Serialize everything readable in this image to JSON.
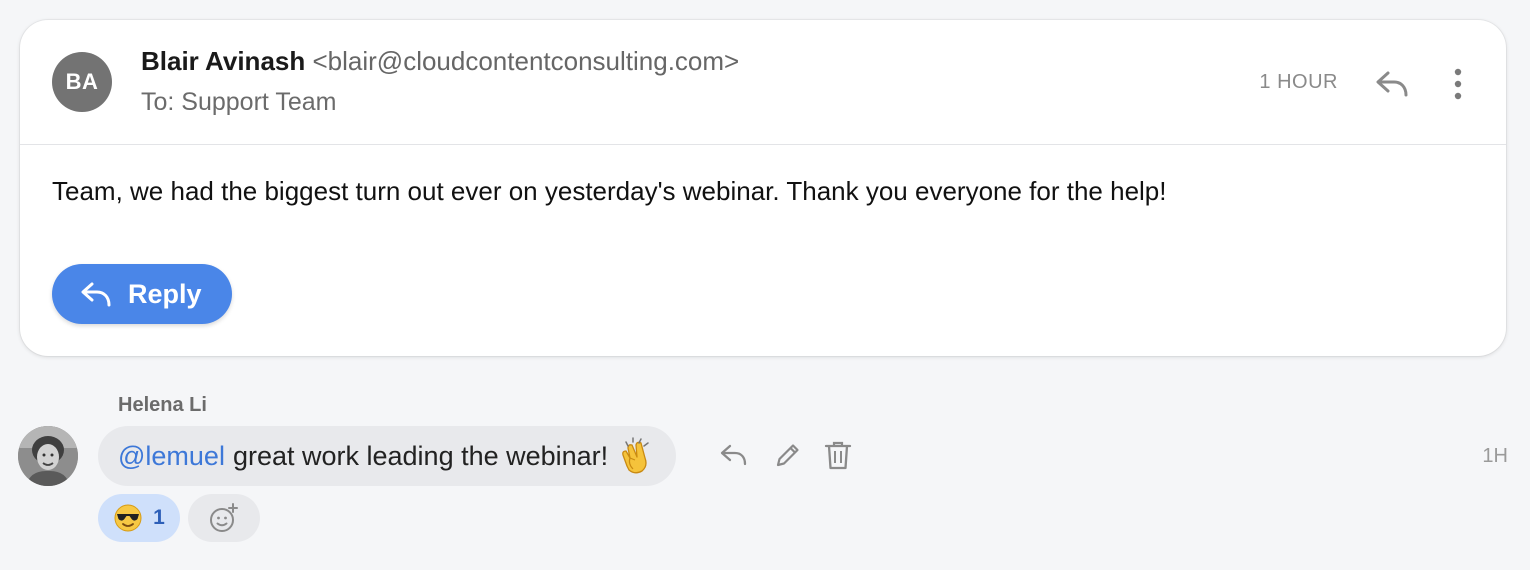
{
  "message": {
    "avatar_initials": "BA",
    "sender_name": "Blair Avinash",
    "sender_email": "<blair@cloudcontentconsulting.com>",
    "to_line": "To: Support Team",
    "time": "1 HOUR",
    "body": "Team, we had the biggest turn out ever on yesterday's webinar. Thank you everyone for the help!",
    "reply_label": "Reply",
    "reply_button_color": "#4a86e8",
    "avatar_color": "#737373",
    "icons": [
      "reply-icon",
      "more-vertical-icon"
    ]
  },
  "comment": {
    "author": "Helena Li",
    "mention": "@lemuel",
    "text": "great work leading the webinar!",
    "text_emoji": "clapping-hands-emoji",
    "time": "1H",
    "mention_color": "#3d78d8",
    "actions": [
      "reply-icon",
      "edit-pencil-icon",
      "trash-icon"
    ],
    "reactions": [
      {
        "emoji": "smiling-face-with-sunglasses-emoji",
        "count": "1",
        "chip_color": "#cfe0fb"
      }
    ],
    "add_reaction_icon": "add-emoji-icon"
  }
}
